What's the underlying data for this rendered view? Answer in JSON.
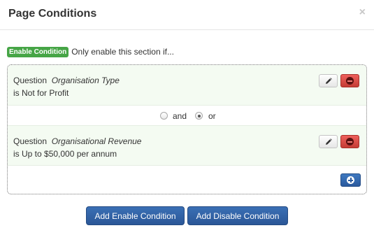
{
  "modal": {
    "title": "Page Conditions",
    "close_glyph": "×"
  },
  "intro": {
    "badge": "Enable Condition",
    "text": "Only enable this section if..."
  },
  "conditions": [
    {
      "prefix": "Question",
      "question": "Organisation Type",
      "value": "is Not for Profit"
    },
    {
      "prefix": "Question",
      "question": "Organisational Revenue",
      "value": "is Up to $50,000 per annum"
    }
  ],
  "logic": {
    "options": [
      "and",
      "or"
    ],
    "selected": "or"
  },
  "icons": {
    "edit": "pencil-icon",
    "delete": "minus-circle-icon",
    "add": "plus-circle-icon"
  },
  "buttons": {
    "add_enable": "Add Enable Condition",
    "add_disable": "Add Disable Condition"
  },
  "colors": {
    "badge_green": "#46a546",
    "delete_red": "#d9534f",
    "primary_blue": "#2f62a6",
    "row_bg": "#f4fbf2"
  }
}
